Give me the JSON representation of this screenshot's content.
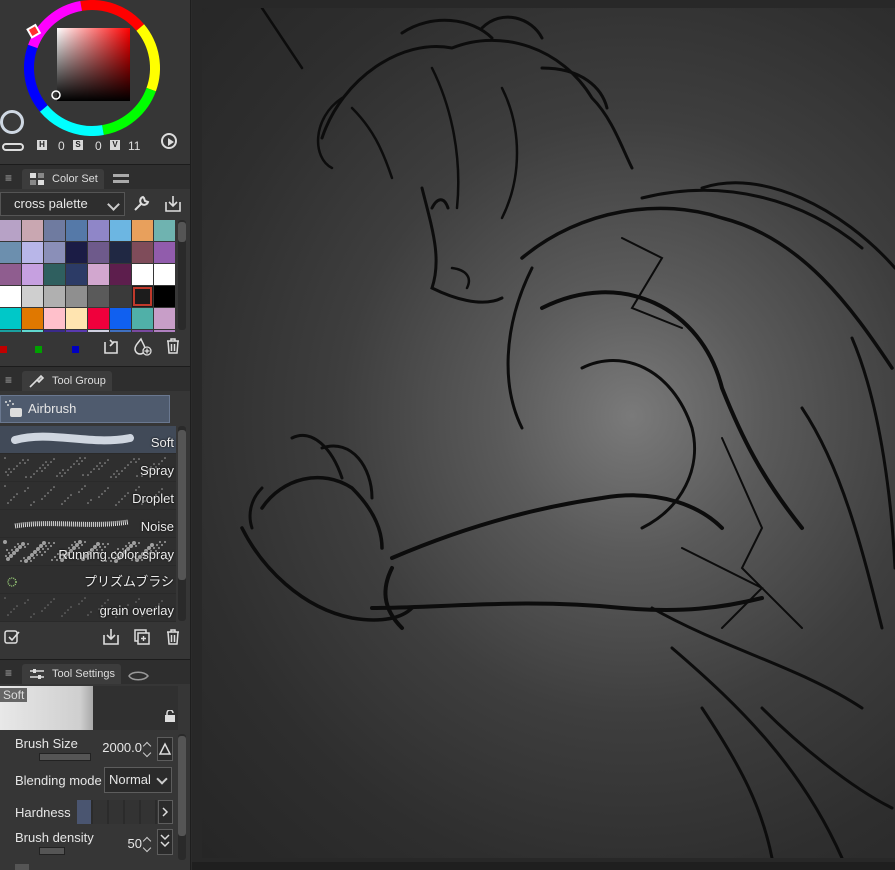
{
  "color_panel": {
    "hsv": {
      "h_label": "H",
      "h_value": "0",
      "s_label": "S",
      "s_value": "0",
      "v_label": "V",
      "v_value": "11"
    },
    "current_color": "#1c1c1c"
  },
  "color_set": {
    "tab_label": "Color Set",
    "palette_name": "cross palette",
    "swatches": [
      [
        "#b7a2c6",
        "#c9a7b1",
        "#6f7ba0",
        "#5579a8",
        "#8f86c8",
        "#6cb6e2",
        "#e8a05c",
        "#6fb3b0"
      ],
      [
        "#6c8fae",
        "#b8b6e8",
        "#8a8fb8",
        "#1b1c45",
        "#6e5a8b",
        "#202843",
        "#7f4c5a",
        "#915cac"
      ],
      [
        "#8f5d8f",
        "#c6a0e0",
        "#2f5f5f",
        "#2c3b66",
        "#d2a7cf",
        "#5d1e4d",
        "#ffffff",
        "#ffffff"
      ],
      [
        "#ffffff",
        "#cfcfcf",
        "#b0b0b0",
        "#8f8f8f",
        "#5a5a5a",
        "#3a3a3a",
        "#1c1c1c",
        "#000000"
      ],
      [
        "#00c8c8",
        "#e07800",
        "#ffc0cb",
        "#ffe4b0",
        "#f0003c",
        "#1060f0",
        "#50b0a8",
        "#c89ec8"
      ],
      [
        "#1aa0a0",
        "#60d8d0",
        "#3a2a8a",
        "#5a3ab0",
        "#d0d0e0",
        "#4070c0",
        "#7a4aa0",
        "#b080c0"
      ]
    ],
    "dots": [
      "#c00000",
      "#00a000",
      "#0000c0"
    ]
  },
  "tool_group": {
    "tab_label": "Tool Group",
    "group_name": "Airbrush",
    "brushes": [
      {
        "name": "Soft",
        "selected": true
      },
      {
        "name": "Spray",
        "selected": false
      },
      {
        "name": "Droplet",
        "selected": false
      },
      {
        "name": "Noise",
        "selected": false
      },
      {
        "name": "Running color spray",
        "selected": false
      },
      {
        "name": "プリズムブラシ",
        "selected": false
      },
      {
        "name": "grain overlay",
        "selected": false
      }
    ]
  },
  "tool_settings": {
    "tab_label": "Tool Settings",
    "preview_label": "Soft",
    "brush_size_label": "Brush Size",
    "brush_size_value": "2000.0",
    "blending_mode_label": "Blending mode",
    "blending_mode_value": "Normal",
    "hardness_label": "Hardness",
    "hardness_level": 1,
    "brush_density_label": "Brush density",
    "brush_density_value": "50"
  }
}
